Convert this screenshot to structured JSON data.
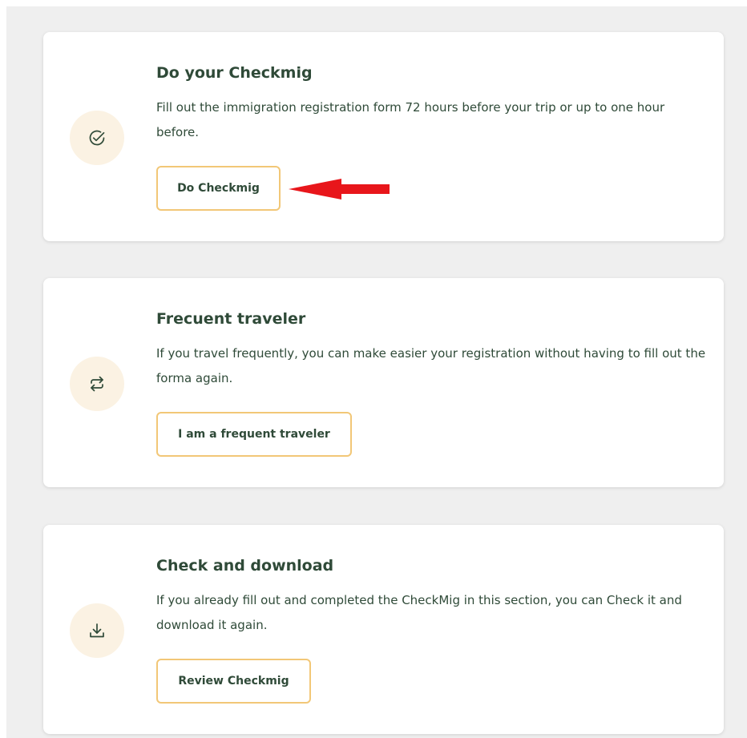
{
  "cards": [
    {
      "title": "Do your Checkmig",
      "description": "Fill out the immigration registration form 72 hours before your trip or up to one hour before.",
      "button": "Do Checkmig",
      "icon": "check-circle-icon"
    },
    {
      "title": "Frecuent traveler",
      "description": "If you travel frequently, you can make easier your registration without having to fill out the forma again.",
      "button": "I am a frequent traveler",
      "icon": "repeat-arrows-icon"
    },
    {
      "title": "Check and download",
      "description": "If you already fill out and completed the CheckMig in this section, you can Check it and download it again.",
      "button": "Review Checkmig",
      "icon": "download-icon"
    }
  ],
  "colors": {
    "background": "#efefef",
    "card": "#ffffff",
    "text": "#2f4a38",
    "icon_circle": "#fbf2e3",
    "button_border": "#f2c777",
    "annotation_arrow": "#e8161b"
  }
}
